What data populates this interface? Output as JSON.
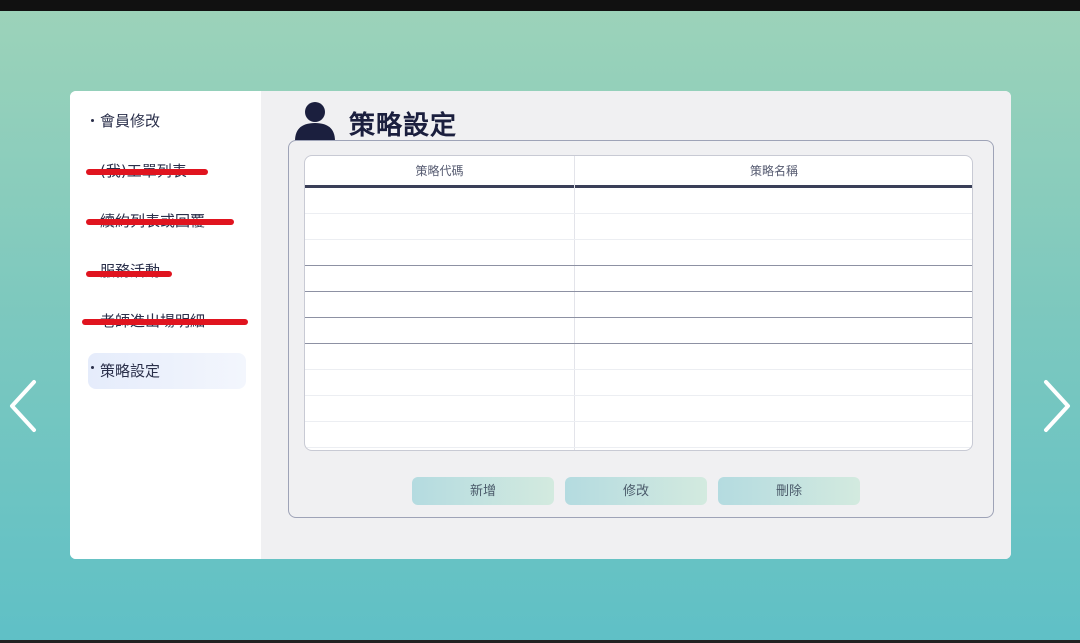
{
  "sidebar": {
    "items": [
      {
        "label": "會員修改",
        "redacted": false,
        "active": false
      },
      {
        "label": "(我)工單列表",
        "redacted": true,
        "active": false
      },
      {
        "label": "續約列表或回覆",
        "redacted": true,
        "active": false
      },
      {
        "label": "服務活動",
        "redacted": true,
        "active": false
      },
      {
        "label": "老師進出場明細",
        "redacted": true,
        "active": false
      },
      {
        "label": "策略設定",
        "redacted": false,
        "active": true
      }
    ],
    "redaction_color": "#e0141f"
  },
  "header": {
    "title": "策略設定",
    "icon": "person-icon"
  },
  "table": {
    "columns": [
      "策略代碼",
      "策略名稱"
    ],
    "rows": [
      [
        "",
        ""
      ],
      [
        "",
        ""
      ],
      [
        "",
        ""
      ],
      [
        "",
        ""
      ],
      [
        "",
        ""
      ],
      [
        "",
        ""
      ],
      [
        "",
        ""
      ],
      [
        "",
        ""
      ],
      [
        "",
        ""
      ],
      [
        "",
        ""
      ]
    ]
  },
  "buttons": {
    "add": "新增",
    "edit": "修改",
    "delete": "刪除"
  },
  "navigation": {
    "prev_icon": "chevron-left-icon",
    "next_icon": "chevron-right-icon"
  },
  "colors": {
    "accent": "#1b1f3e",
    "background_top": "#9dd3b9",
    "background_bottom": "#5fc0c6",
    "button": "#b4dbe0"
  }
}
